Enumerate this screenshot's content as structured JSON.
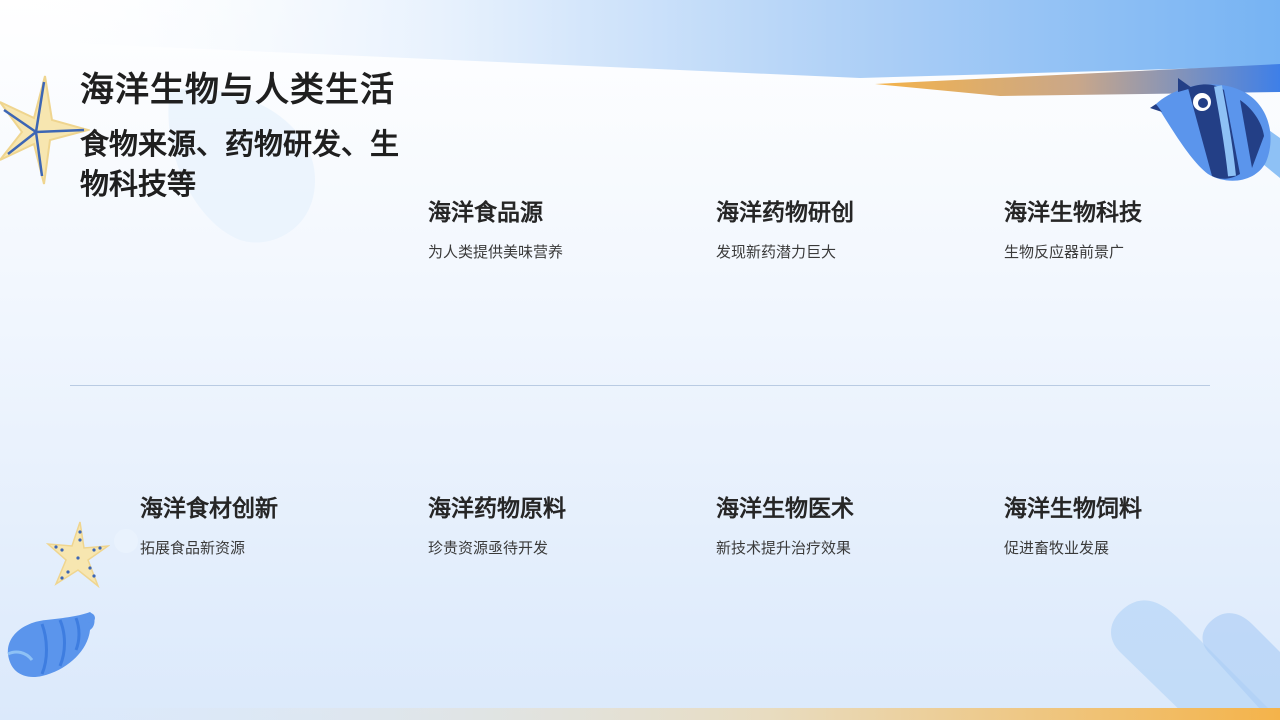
{
  "title": "海洋生物与人类生活",
  "subtitle": "食物来源、药物研发、生物科技等",
  "row1": [
    {
      "title": "海洋食品源",
      "desc": "为人类提供美味营养"
    },
    {
      "title": "海洋药物研创",
      "desc": "发现新药潜力巨大"
    },
    {
      "title": "海洋生物科技",
      "desc": "生物反应器前景广"
    }
  ],
  "row2": [
    {
      "title": "海洋食材创新",
      "desc": "拓展食品新资源"
    },
    {
      "title": "海洋药物原料",
      "desc": "珍贵资源亟待开发"
    },
    {
      "title": "海洋生物医术",
      "desc": "新技术提升治疗效果"
    },
    {
      "title": "海洋生物饲料",
      "desc": "促进畜牧业发展"
    }
  ],
  "colors": {
    "accent_blue": "#5b95ec",
    "dark_blue": "#233f86",
    "accent_orange": "#f2b44a",
    "starfish_yellow": "#f7e6b0",
    "text": "#1f1f1f"
  },
  "icons": [
    "starfish-icon",
    "fish-icon",
    "seashell-icon",
    "small-starfish-icon"
  ]
}
